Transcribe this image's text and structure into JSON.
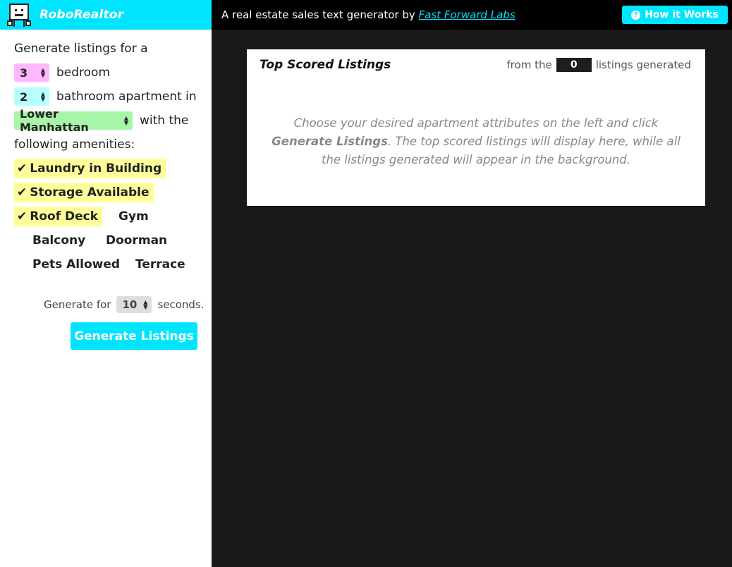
{
  "app": {
    "name": "RoboRealtor",
    "tagline_prefix": "A real estate sales text generator by",
    "tagline_link": "Fast Forward Labs",
    "how_button": "How it Works",
    "accent": "#00e5ff"
  },
  "sidebar": {
    "intro": "Generate listings for a",
    "bedrooms": "3",
    "bedroom_label": "bedroom",
    "bathrooms": "2",
    "bathroom_label": "bathroom apartment in",
    "neighborhood": "Lower Manhattan",
    "with_label": "with the",
    "amenities_label": "following amenities:",
    "amenities": [
      {
        "label": "Laundry in Building",
        "selected": true
      },
      {
        "label": "Storage Available",
        "selected": true
      },
      {
        "label": "Roof Deck",
        "selected": true
      },
      {
        "label": "Gym",
        "selected": false
      },
      {
        "label": "Balcony",
        "selected": false
      },
      {
        "label": "Doorman",
        "selected": false
      },
      {
        "label": "Pets Allowed",
        "selected": false
      },
      {
        "label": "Terrace",
        "selected": false
      }
    ],
    "generate_for": "Generate for",
    "seconds_value": "10",
    "seconds_label": "seconds.",
    "generate_button": "Generate Listings"
  },
  "main": {
    "panel_title": "Top Scored Listings",
    "from_the": "from the",
    "count": "0",
    "listings_generated": "listings generated",
    "msg_1": "Choose your desired apartment attributes on the left and click ",
    "msg_bold": "Generate Listings",
    "msg_2": ". The top scored listings will display here, while all the listings generated will appear in the background."
  }
}
